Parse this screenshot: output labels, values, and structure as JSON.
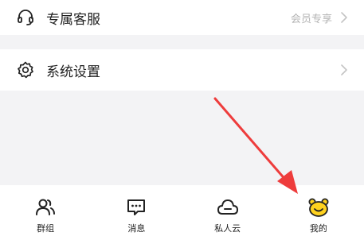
{
  "menu": {
    "support": {
      "label": "专属客服",
      "hint": "会员专享",
      "icon": "headset-icon"
    },
    "settings": {
      "label": "系统设置",
      "icon": "gear-icon"
    }
  },
  "tabbar": {
    "tabs": [
      {
        "label": "群组",
        "icon": "group-icon"
      },
      {
        "label": "消息",
        "icon": "message-icon"
      },
      {
        "label": "私人云",
        "icon": "cloud-icon"
      },
      {
        "label": "我的",
        "icon": "bear-face-icon",
        "active": true
      }
    ]
  },
  "colors": {
    "background": "#f3f3f5",
    "row_bg": "#ffffff",
    "text": "#1f1f1f",
    "hint": "#b3b3b3",
    "accent_yellow": "#ffd21f",
    "annotation_arrow": "#ee3c3c"
  }
}
